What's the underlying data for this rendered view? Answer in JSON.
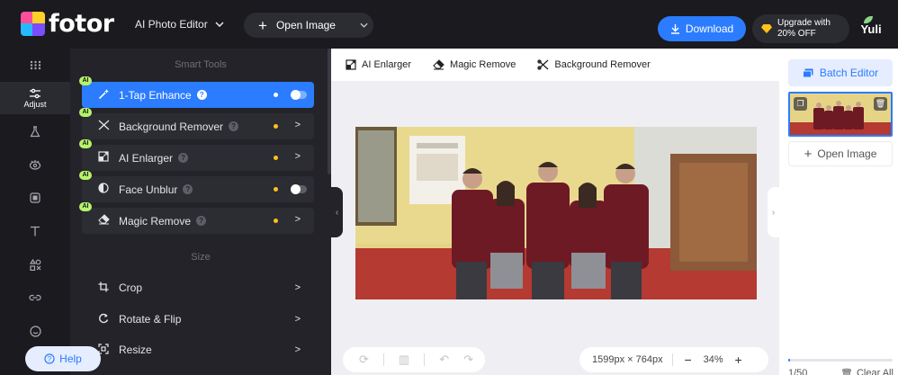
{
  "header": {
    "brand": "fotor",
    "ai_editor_label": "AI Photo Editor",
    "open_image_label": "Open Image",
    "download_label": "Download",
    "upgrade_line1": "Upgrade with",
    "upgrade_line2": "20% OFF",
    "user_name": "Yuli"
  },
  "rail": {
    "items": [
      {
        "icon": "grid-icon"
      },
      {
        "icon": "adjust-icon",
        "label": "Adjust",
        "active": true
      },
      {
        "icon": "beaker-icon"
      },
      {
        "icon": "eye-icon"
      },
      {
        "icon": "frame-icon"
      },
      {
        "icon": "text-icon"
      },
      {
        "icon": "elements-icon"
      },
      {
        "icon": "link-icon"
      },
      {
        "icon": "smiley-icon"
      }
    ]
  },
  "tools_panel": {
    "smart_tools_title": "Smart Tools",
    "size_title": "Size",
    "smart_tools": [
      {
        "label": "1-Tap Enhance",
        "badge": "AI",
        "control": "toggle",
        "active": true
      },
      {
        "label": "Background Remover",
        "badge": "AI",
        "control": "arrow"
      },
      {
        "label": "AI Enlarger",
        "badge": "AI",
        "control": "arrow"
      },
      {
        "label": "Face Unblur",
        "badge": "AI",
        "control": "toggle"
      },
      {
        "label": "Magic Remove",
        "badge": "AI",
        "control": "arrow"
      }
    ],
    "size_tools": [
      {
        "label": "Crop"
      },
      {
        "label": "Rotate & Flip"
      },
      {
        "label": "Resize"
      }
    ]
  },
  "canvas_toolbar": {
    "items": [
      {
        "label": "AI Enlarger",
        "icon": "enlarger-icon"
      },
      {
        "label": "Magic Remove",
        "icon": "eraser-icon"
      },
      {
        "label": "Background Remover",
        "icon": "scissors-icon"
      }
    ]
  },
  "canvas": {
    "dimensions": "1599px × 764px",
    "zoom": "34%"
  },
  "right_panel": {
    "batch_editor_label": "Batch Editor",
    "open_image_label": "Open Image",
    "counter": "1/50",
    "progress": 0.02,
    "clear_all_label": "Clear All",
    "help_label": "Help"
  },
  "colors": {
    "accent": "#2b7cff",
    "dark_bg": "#1a1a1f",
    "panel_bg": "#232329",
    "ai_badge": "#b7f36a",
    "highlight_dot": "#ffc21a"
  }
}
